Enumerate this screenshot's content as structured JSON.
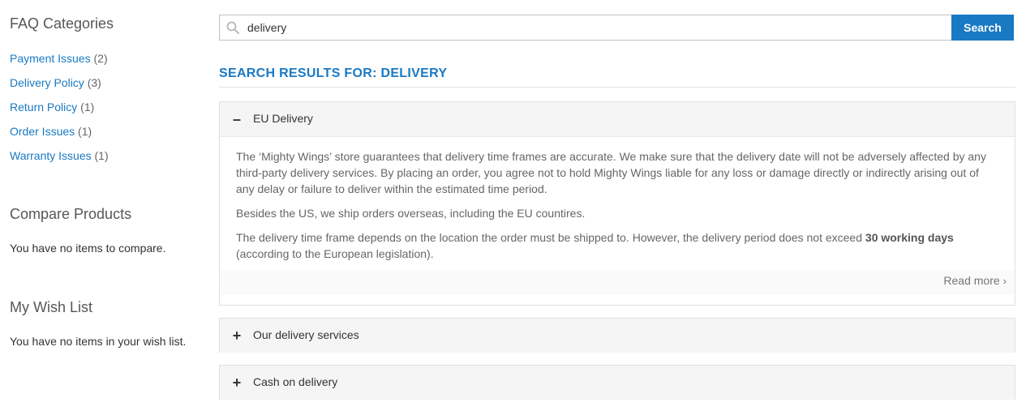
{
  "sidebar": {
    "faq_title": "FAQ Categories",
    "categories": [
      {
        "label": "Payment Issues",
        "count": "(2)"
      },
      {
        "label": "Delivery Policy",
        "count": "(3)"
      },
      {
        "label": "Return Policy",
        "count": "(1)"
      },
      {
        "label": "Order Issues",
        "count": "(1)"
      },
      {
        "label": "Warranty Issues",
        "count": "(1)"
      }
    ],
    "compare_title": "Compare Products",
    "compare_empty": "You have no items to compare.",
    "wishlist_title": "My Wish List",
    "wishlist_empty": "You have no items in your wish list."
  },
  "search": {
    "value": "delivery",
    "icon": "search-icon",
    "button_label": "Search"
  },
  "results": {
    "title": "SEARCH RESULTS FOR: DELIVERY",
    "items": [
      {
        "toggle": "–",
        "title": "EU Delivery",
        "expanded": true,
        "paragraphs": [
          "The ‘Mighty Wings’ store guarantees that delivery time frames are accurate. We make sure that the delivery date will not be adversely affected by any third-party delivery services. By placing an order, you agree not to hold Mighty Wings liable for any loss or damage directly or indirectly arising out of any delay or failure to deliver within the estimated time period.",
          "Besides the US, we ship orders overseas, including the EU countires."
        ],
        "p3_before": "The delivery time frame depends on the location the order must be shipped to. However, the delivery period does not exceed ",
        "p3_bold": "30 working days",
        "p3_after": " (according to the European legislation).",
        "read_more": "Read more",
        "read_more_arrow": "›"
      },
      {
        "toggle": "+",
        "title": "Our delivery services",
        "expanded": false
      },
      {
        "toggle": "+",
        "title": "Cash on delivery",
        "expanded": false
      }
    ]
  },
  "colors": {
    "accent": "#1979c3",
    "panel_header": "#f5f5f5",
    "border": "#e0e0e0"
  }
}
